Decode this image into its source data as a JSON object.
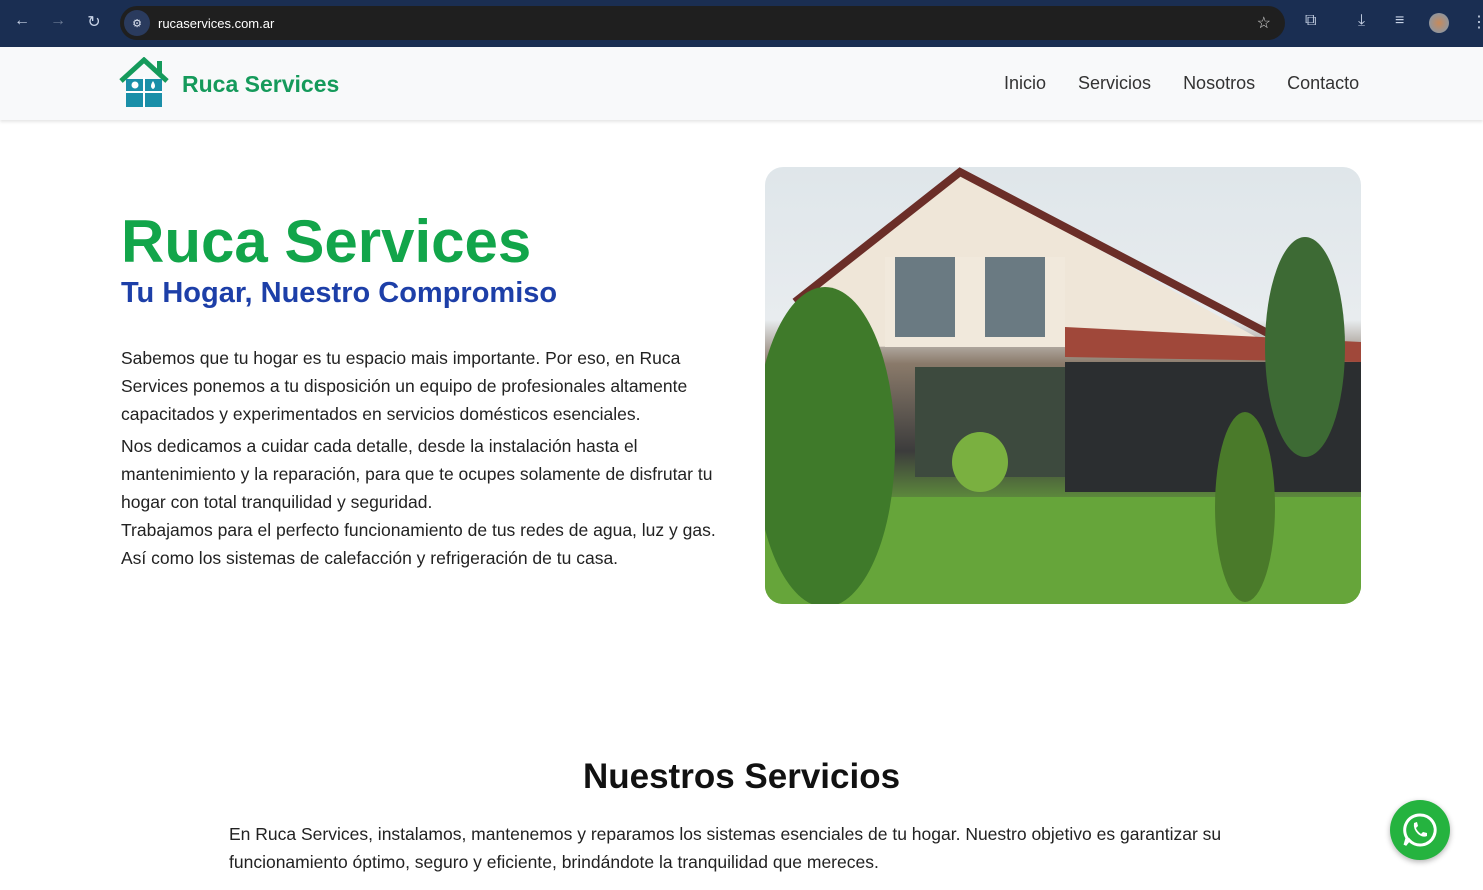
{
  "browser": {
    "url": "rucaservices.com.ar"
  },
  "header": {
    "brand": "Ruca Services",
    "nav": [
      "Inicio",
      "Servicios",
      "Nosotros",
      "Contacto"
    ]
  },
  "hero": {
    "title": "Ruca Services",
    "subtitle": "Tu Hogar, Nuestro Compromiso",
    "paragraphs": [
      "Sabemos que tu hogar es tu espacio mais importante. Por eso, en Ruca Services ponemos a tu disposición un equipo de profesionales altamente capacitados y experimentados en servicios domésticos esenciales.",
      "Nos dedicamos a cuidar cada detalle, desde la instalación hasta el mantenimiento y la reparación, para que te ocupes solamente de disfrutar tu hogar con total tranquilidad y seguridad.",
      "Trabajamos para el perfecto funcionamiento de tus redes de agua, luz y gas. Así como los sistemas de calefacción y refrigeración de tu casa."
    ]
  },
  "services": {
    "title": "Nuestros Servicios",
    "text": "En Ruca Services, instalamos, mantenemos y reparamos los sistemas esenciales de tu hogar. Nuestro objetivo es garantizar su funcionamiento óptimo, seguro y eficiente, brindándote la tranquilidad que mereces."
  }
}
